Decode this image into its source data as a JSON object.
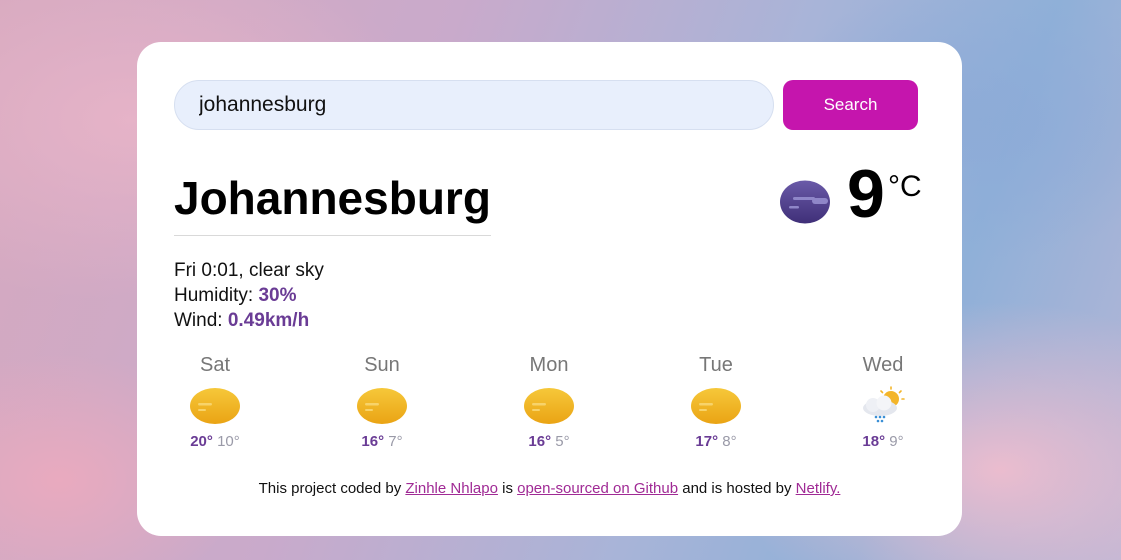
{
  "search": {
    "value": "johannesburg",
    "button_label": "Search"
  },
  "current": {
    "city": "Johannesburg",
    "description": "Fri 0:01, clear sky",
    "humidity_label": "Humidity: ",
    "humidity_value": "30%",
    "wind_label": "Wind: ",
    "wind_value": "0.49km/h",
    "temperature": "9",
    "unit": "°C",
    "icon": "night-clear-moon-icon"
  },
  "forecast": [
    {
      "day": "Sat",
      "max": "20°",
      "min": "10°",
      "icon": "sun-icon"
    },
    {
      "day": "Sun",
      "max": "16°",
      "min": "7°",
      "icon": "sun-icon"
    },
    {
      "day": "Mon",
      "max": "16°",
      "min": "5°",
      "icon": "sun-icon"
    },
    {
      "day": "Tue",
      "max": "17°",
      "min": "8°",
      "icon": "sun-icon"
    },
    {
      "day": "Wed",
      "max": "18°",
      "min": "9°",
      "icon": "rain-cloud-sun-icon"
    }
  ],
  "footer": {
    "text1": "This project coded by ",
    "author": "Zinhle Nhlapo",
    "text2": " is ",
    "repo_link": "open-sourced on Github",
    "text3": " and is hosted by ",
    "host_link": "Netlify."
  },
  "colors": {
    "accent_button": "#c515ad",
    "value_purple": "#6a3c95",
    "link": "#a02a95"
  }
}
